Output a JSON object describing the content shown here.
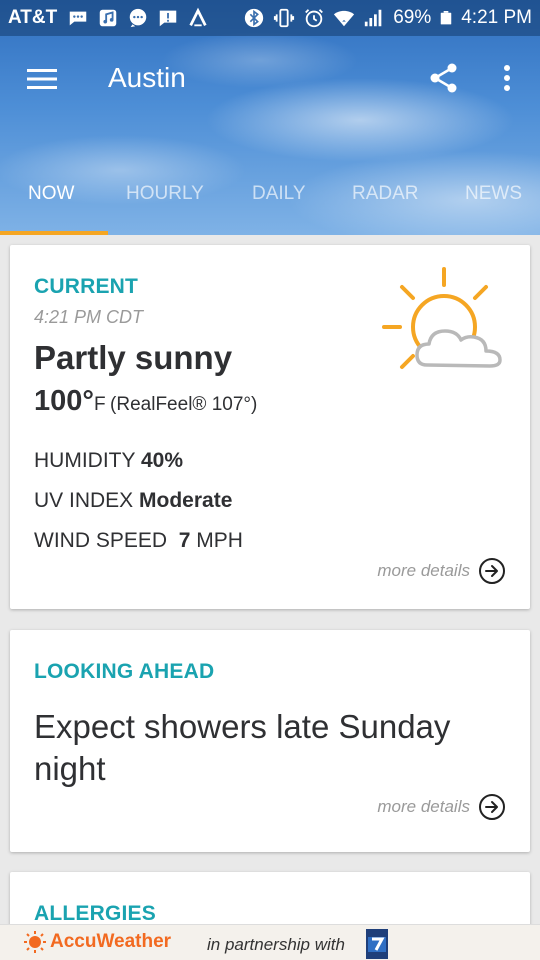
{
  "status_bar": {
    "carrier": "AT&T",
    "battery_percent": "69%",
    "time": "4:21 PM",
    "icons": [
      "message-icon",
      "music-icon",
      "chat-icon",
      "alert-icon",
      "app-icon",
      "bluetooth-icon",
      "vibrate-icon",
      "alarm-icon",
      "wifi-icon",
      "signal-icon",
      "battery-icon"
    ]
  },
  "toolbar": {
    "city": "Austin",
    "menu_icon": "hamburger-menu-icon",
    "share_icon": "share-icon",
    "more_icon": "more-vert-icon"
  },
  "tabs": [
    {
      "label": "NOW",
      "active": true
    },
    {
      "label": "HOURLY",
      "active": false
    },
    {
      "label": "DAILY",
      "active": false
    },
    {
      "label": "RADAR",
      "active": false
    },
    {
      "label": "NEWS",
      "active": false
    }
  ],
  "current": {
    "section_label": "CURRENT",
    "time": "4:21 PM CDT",
    "condition": "Partly sunny",
    "temperature": "100°",
    "unit": "F",
    "realfeel": "(RealFeel® 107°)",
    "humidity_label": "HUMIDITY",
    "humidity_value": "40%",
    "uv_label": "UV INDEX",
    "uv_value": "Moderate",
    "wind_label": "WIND SPEED",
    "wind_value": "7",
    "wind_unit": "MPH",
    "more_details": "more details",
    "weather_icon": "partly-sunny-icon"
  },
  "looking_ahead": {
    "section_label": "LOOKING AHEAD",
    "text": "Expect showers late Sunday night",
    "more_details": "more details"
  },
  "allergies": {
    "section_label": "ALLERGIES"
  },
  "footer": {
    "brand": "AccuWeather",
    "partner_text": "in partnership with",
    "partner_logo": "fox-7-news-logo"
  },
  "colors": {
    "accent": "#1aa3b0",
    "tab_indicator": "#f5a623",
    "sun": "#f5a623",
    "brand": "#f26a21"
  }
}
